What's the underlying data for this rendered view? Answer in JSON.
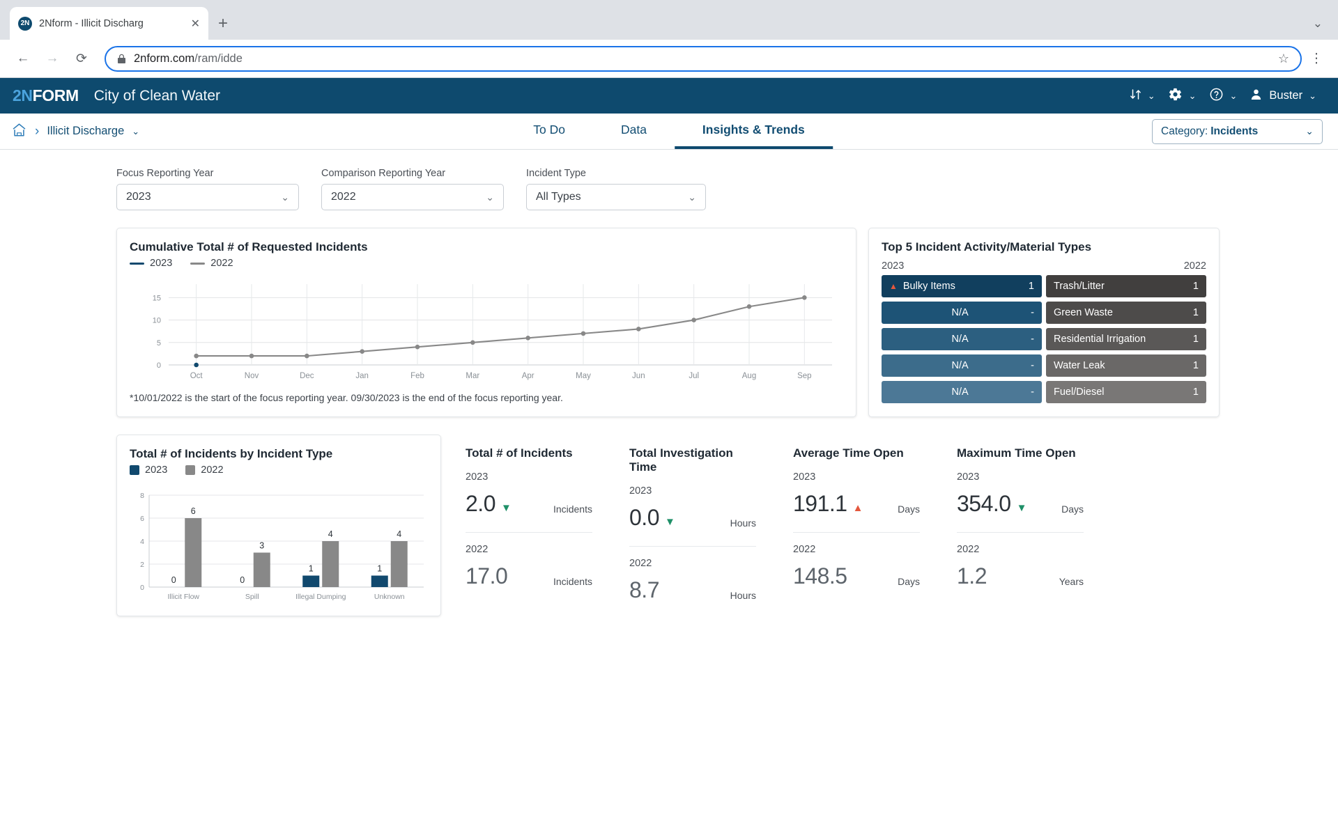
{
  "browser": {
    "tab_title": "2Nform - Illicit Discharg",
    "favicon_text": "2N",
    "close_icon": "close-icon",
    "new_tab_icon": "plus-icon",
    "url_bold": "2nform.com",
    "url_rest": "/ram/idde",
    "back_icon": "back-arrow-icon",
    "forward_icon": "forward-arrow-icon",
    "reload_icon": "reload-icon",
    "bookmark_icon": "star-icon",
    "menu_icon": "kebab-menu-icon",
    "tablist_icon": "chevron-down-icon"
  },
  "header": {
    "logo_num": "2N",
    "logo_rest": "FORM",
    "org": "City of Clean Water",
    "sort_icon": "sort-arrows-icon",
    "settings_icon": "gear-icon",
    "help_icon": "question-circle-icon",
    "avatar_icon": "user-avatar-icon",
    "user": "Buster",
    "caret": "⌄"
  },
  "navbar": {
    "home_icon": "home-icon",
    "separator": "›",
    "breadcrumb": "Illicit Discharge",
    "breadcrumb_caret": "⌄",
    "tabs": [
      {
        "label": "To Do",
        "active": false
      },
      {
        "label": "Data",
        "active": false
      },
      {
        "label": "Insights & Trends",
        "active": true
      }
    ],
    "category_prefix": "Category:",
    "category_value": "Incidents",
    "category_caret": "⌄"
  },
  "filters": [
    {
      "label": "Focus Reporting Year",
      "value": "2023"
    },
    {
      "label": "Comparison Reporting Year",
      "value": "2022"
    },
    {
      "label": "Incident Type",
      "value": "All Types"
    }
  ],
  "line_card": {
    "title": "Cumulative Total # of Requested Incidents",
    "legend": [
      {
        "label": "2023",
        "color": "#11496e"
      },
      {
        "label": "2022",
        "color": "#888888"
      }
    ],
    "footnote": "*10/01/2022 is the start of the focus reporting year. 09/30/2023 is the end of the focus reporting year."
  },
  "top5_card": {
    "title": "Top 5 Incident Activity/Material Types",
    "focus_year": "2023",
    "comparison_year": "2022",
    "focus_rows": [
      {
        "label": "Bulky Items",
        "value": "1",
        "color": "#113f5e",
        "arrow": "up",
        "arrow_color": "#e4573d"
      },
      {
        "label": "N/A",
        "value": "-",
        "color": "#1d5376",
        "arrow": null
      },
      {
        "label": "N/A",
        "value": "-",
        "color": "#2c5f80",
        "arrow": null
      },
      {
        "label": "N/A",
        "value": "-",
        "color": "#3c6c8b",
        "arrow": null
      },
      {
        "label": "N/A",
        "value": "-",
        "color": "#4c7896",
        "arrow": null
      }
    ],
    "comparison_rows": [
      {
        "label": "Trash/Litter",
        "value": "1",
        "color": "#413f3e"
      },
      {
        "label": "Green Waste",
        "value": "1",
        "color": "#4d4b4a"
      },
      {
        "label": "Residential Irrigation",
        "value": "1",
        "color": "#5a5857"
      },
      {
        "label": "Water Leak",
        "value": "1",
        "color": "#6a6867"
      },
      {
        "label": "Fuel/Diesel",
        "value": "1",
        "color": "#797776"
      }
    ]
  },
  "bar_card": {
    "title": "Total # of Incidents by Incident Type",
    "legend": [
      {
        "label": "2023",
        "color": "#11496e"
      },
      {
        "label": "2022",
        "color": "#888888"
      }
    ]
  },
  "kpi_cards": [
    {
      "title": "Total # of Incidents",
      "focus_year": "2023",
      "focus_value": "2.0",
      "focus_unit": "Incidents",
      "trend": "down",
      "comparison_year": "2022",
      "comparison_value": "17.0",
      "comparison_unit": "Incidents"
    },
    {
      "title": "Total Investigation Time",
      "focus_year": "2023",
      "focus_value": "0.0",
      "focus_unit": "Hours",
      "trend": "down",
      "comparison_year": "2022",
      "comparison_value": "8.7",
      "comparison_unit": "Hours"
    },
    {
      "title": "Average Time Open",
      "focus_year": "2023",
      "focus_value": "191.1",
      "focus_unit": "Days",
      "trend": "up",
      "comparison_year": "2022",
      "comparison_value": "148.5",
      "comparison_unit": "Days"
    },
    {
      "title": "Maximum Time Open",
      "focus_year": "2023",
      "focus_value": "354.0",
      "focus_unit": "Days",
      "trend": "down",
      "comparison_year": "2022",
      "comparison_value": "1.2",
      "comparison_unit": "Years"
    }
  ],
  "chart_data": [
    {
      "type": "line",
      "title": "Cumulative Total # of Requested Incidents",
      "xlabel": "",
      "ylabel": "",
      "x": [
        "Oct",
        "Nov",
        "Dec",
        "Jan",
        "Feb",
        "Mar",
        "Apr",
        "May",
        "Jun",
        "Jul",
        "Aug",
        "Sep"
      ],
      "yticks": [
        0,
        5,
        10,
        15
      ],
      "ylim": [
        0,
        18
      ],
      "grid": true,
      "legend_position": "top-left",
      "series": [
        {
          "name": "2023",
          "color": "#11496e",
          "values": [
            0,
            null,
            null,
            null,
            null,
            null,
            null,
            null,
            null,
            null,
            null,
            null
          ]
        },
        {
          "name": "2022",
          "color": "#888888",
          "values": [
            2,
            2,
            2,
            3,
            4,
            5,
            6,
            7,
            8,
            10,
            13,
            15
          ]
        }
      ]
    },
    {
      "type": "bar",
      "title": "Total # of Incidents by Incident Type",
      "categories": [
        "Illicit Flow",
        "Spill",
        "Illegal Dumping",
        "Unknown"
      ],
      "yticks": [
        0,
        2,
        4,
        6,
        8
      ],
      "ylim": [
        0,
        8
      ],
      "grid": true,
      "legend_position": "top-left",
      "series": [
        {
          "name": "2023",
          "color": "#11496e",
          "values": [
            0,
            0,
            1,
            1
          ]
        },
        {
          "name": "2022",
          "color": "#888888",
          "values": [
            6,
            3,
            4,
            4
          ]
        }
      ]
    }
  ]
}
